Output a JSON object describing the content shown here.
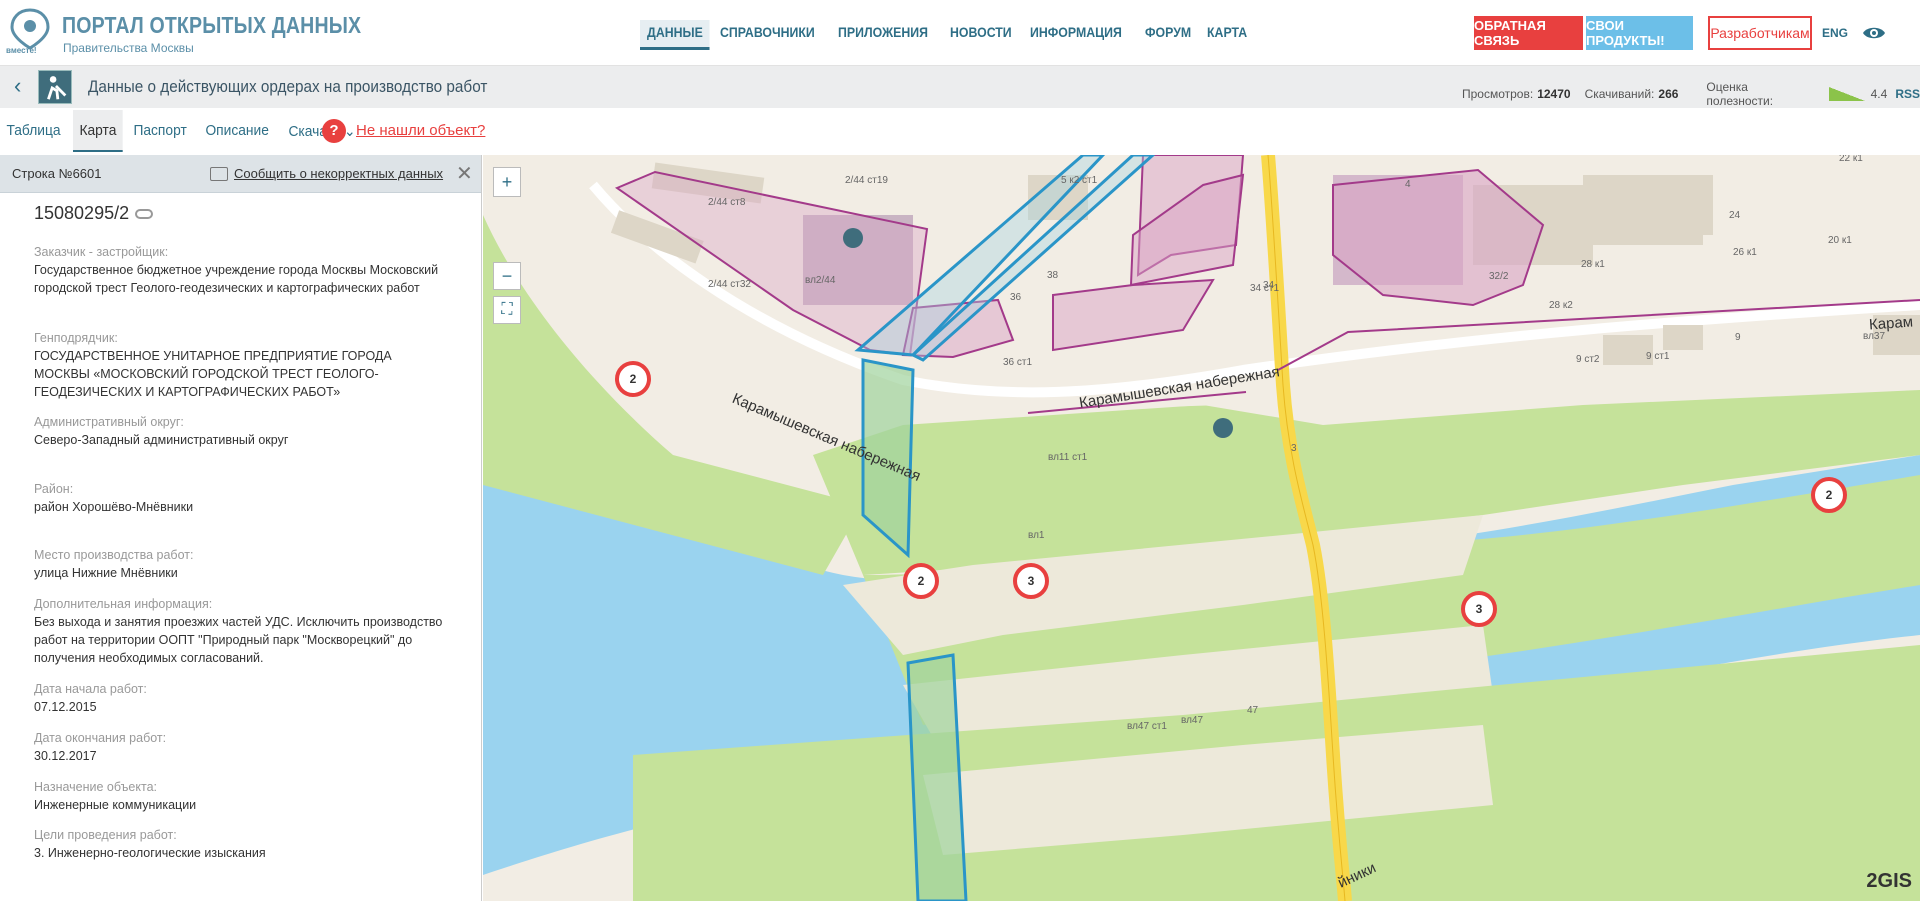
{
  "header": {
    "logo_small": "вместе!",
    "title": "ПОРТАЛ ОТКРЫТЫХ ДАННЫХ",
    "subtitle": "Правительства Москвы",
    "nav": [
      "ДАННЫЕ",
      "СПРАВОЧНИКИ",
      "ПРИЛОЖЕНИЯ",
      "НОВОСТИ",
      "ИНФОРМАЦИЯ",
      "ФОРУМ",
      "КАРТА"
    ],
    "feedback_label": "ОБРАТНАЯ СВЯЗЬ",
    "products_label": "СВОИ ПРОДУКТЫ!",
    "developers_label": "Разработчикам",
    "lang_label": "ENG"
  },
  "dataset": {
    "title": "Данные о действующих ордерах на производство работ",
    "views_label": "Просмотров:",
    "views": "12470",
    "downloads_label": "Скачиваний:",
    "downloads": "266",
    "rating_label": "Оценка полезности:",
    "rating": "4.4",
    "rss": "RSS"
  },
  "tabs": {
    "table": "Таблица",
    "map": "Карта",
    "passport": "Паспорт",
    "description": "Описание",
    "download": "Скачать",
    "help": "?",
    "not_found": "Не нашли объект?"
  },
  "record": {
    "row_label": "Строка №6601",
    "report_label": "Сообщить о некорректных данных",
    "id": "15080295/2",
    "fields": [
      {
        "label": "Заказчик - застройщик:",
        "value": "Государственное бюджетное учреждение города Москвы Московский городской трест Геолого-геодезических и картографических работ"
      },
      {
        "label": "Генподрядчик:",
        "value": "ГОСУДАРСТВЕННОЕ УНИТАРНОЕ ПРЕДПРИЯТИЕ ГОРОДА МОСКВЫ «МОСКОВСКИЙ ГОРОДСКОЙ ТРЕСТ ГЕОЛОГО-ГЕОДЕЗИЧЕСКИХ И КАРТОГРАФИЧЕСКИХ РАБОТ»"
      },
      {
        "label": "Административный округ:",
        "value": "Северо-Западный административный округ"
      },
      {
        "label": "Район:",
        "value": "район Хорошёво-Мнёвники"
      },
      {
        "label": "Место производства работ:",
        "value": "улица Нижние Мнёвники"
      },
      {
        "label": "Дополнительная информация:",
        "value": "Без выхода и занятия проезжих частей УДС. Исключить производство работ на территории ООПТ \"Природный парк \"Москворецкий\" до получения необходимых согласований."
      },
      {
        "label": "Дата начала работ:",
        "value": "07.12.2015"
      },
      {
        "label": "Дата окончания работ:",
        "value": "30.12.2017"
      },
      {
        "label": "Назначение объекта:",
        "value": "Инженерные коммуникации"
      },
      {
        "label": "Цели проведения работ:",
        "value": "3. Инженерно-геологические изыскания"
      }
    ]
  },
  "map": {
    "street1": "Карамышевская набережная",
    "street2": "Карамышевская набережная",
    "street3": "Карам",
    "street4": "йники",
    "clusters": [
      "2",
      "2",
      "3",
      "3",
      "2"
    ],
    "labels": [
      "2/44 ст19",
      "2/44 ст8",
      "2/44 ст32",
      "вл2/44",
      "5 к2 ст1",
      "38",
      "34",
      "34 ст1",
      "36",
      "36 ст1",
      "4",
      "22 к1",
      "24",
      "20 к1",
      "26 к1",
      "28 к1",
      "32/2",
      "28 к2",
      "9",
      "9 ст2",
      "9 ст1",
      "вл37",
      "вл11 ст1",
      "3",
      "вл1",
      "вл47 ст1",
      "вл47",
      "47"
    ],
    "brand": "2GIS",
    "zoom_in": "+",
    "zoom_out": "−"
  }
}
